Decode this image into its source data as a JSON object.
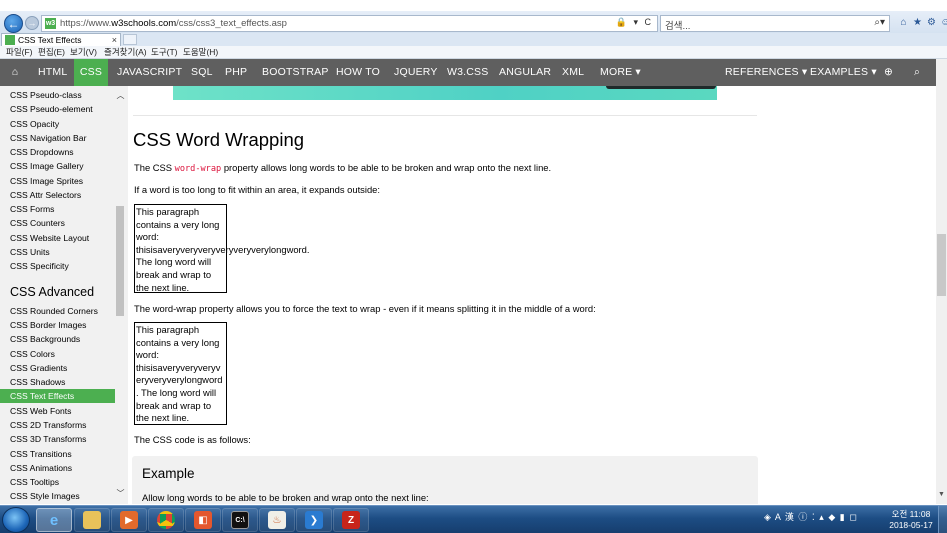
{
  "browser": {
    "url_prefix": "https://www.",
    "url_domain": "w3schools.com",
    "url_path": "/css/css3_text_effects.asp",
    "url_tools": "🔒 ▾ C",
    "search_placeholder": "검색...",
    "search_icon": "search-icon",
    "tab_title": "CSS Text Effects",
    "tab_close": "×",
    "menu": [
      "파일(F)",
      "편집(E)",
      "보기(V)",
      "즐겨찾기(A)",
      "도구(T)",
      "도움말(H)"
    ]
  },
  "topnav": {
    "items": [
      "HTML",
      "CSS",
      "JAVASCRIPT",
      "SQL",
      "PHP",
      "BOOTSTRAP",
      "HOW TO",
      "JQUERY",
      "W3.CSS",
      "ANGULAR",
      "XML",
      "MORE ▾"
    ],
    "right_items": [
      "REFERENCES ▾",
      "EXAMPLES ▾"
    ],
    "active": "CSS",
    "accent_color": "#4caf50"
  },
  "sidebar": {
    "items_top": [
      "CSS Pseudo-class",
      "CSS Pseudo-element",
      "CSS Opacity",
      "CSS Navigation Bar",
      "CSS Dropdowns",
      "CSS Image Gallery",
      "CSS Image Sprites",
      "CSS Attr Selectors",
      "CSS Forms",
      "CSS Counters",
      "CSS Website Layout",
      "CSS Units",
      "CSS Specificity"
    ],
    "heading": "CSS Advanced",
    "items_bottom": [
      "CSS Rounded Corners",
      "CSS Border Images",
      "CSS Backgrounds",
      "CSS Colors",
      "CSS Gradients",
      "CSS Shadows",
      "CSS Text Effects",
      "CSS Web Fonts",
      "CSS 2D Transforms",
      "CSS 3D Transforms",
      "CSS Transitions",
      "CSS Animations",
      "CSS Tooltips",
      "CSS Style Images"
    ],
    "active": "CSS Text Effects"
  },
  "content": {
    "heading": "CSS Word Wrapping",
    "p1_before": "The CSS ",
    "p1_code": "word-wrap",
    "p1_after": " property allows long words to be able to be broken and wrap onto the next line.",
    "p2": "If a word is too long to fit within an area, it expands outside:",
    "demo1_lines": [
      "This paragraph",
      "contains a very long",
      "word:",
      "thisisaveryveryveryveryveryverylongword.",
      "The long word will",
      "break and wrap to",
      "the next line."
    ],
    "p3": "The word-wrap property allows you to force the text to wrap - even if it means splitting it in the middle of a word:",
    "demo2_lines": [
      "This paragraph",
      "contains a very long",
      "word:",
      "thisisaveryveryveryv",
      "eryveryverylongword",
      ". The long word will",
      "break and wrap to",
      "the next line."
    ],
    "p4": "The CSS code is as follows:",
    "example_title": "Example",
    "example_text": "Allow long words to be able to be broken and wrap onto the next line:"
  },
  "taskbar": {
    "apps": [
      "internet-explorer",
      "file-explorer",
      "media-player",
      "chrome",
      "app-5",
      "command-prompt",
      "java",
      "visual-studio-code",
      "filezilla"
    ],
    "tray": "◈ A 漢 ⓘ ⁚ ▴ ◆ ▮ ◻",
    "time": "오전 11:08",
    "date": "2018-05-17"
  }
}
